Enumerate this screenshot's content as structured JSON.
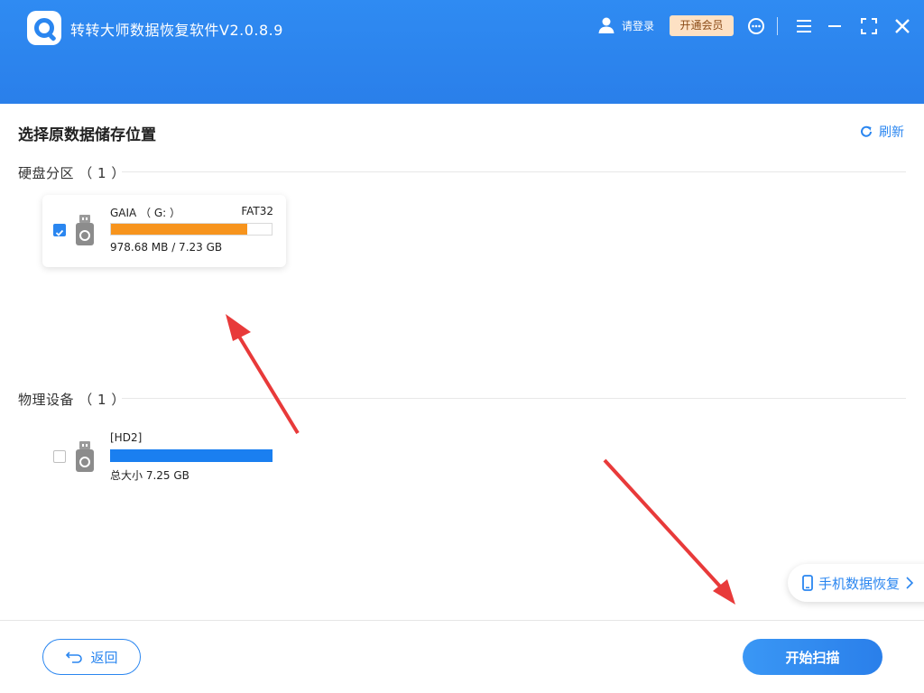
{
  "header": {
    "app_title": "转转大师数据恢复软件V2.0.8.9",
    "login_label": "请登录",
    "vip_label": "开通会员",
    "icons": [
      "logo-icon",
      "user-icon",
      "customer-service-icon",
      "menu-icon",
      "minimize-icon",
      "maximize-icon",
      "close-icon"
    ]
  },
  "main": {
    "page_title": "选择原数据储存位置",
    "refresh_label": "刷新",
    "partitions": {
      "title": "硬盘分区 （ 1 ）",
      "items": [
        {
          "name": "GAIA （ G: ）",
          "fs": "FAT32",
          "size": "978.68 MB / 7.23 GB",
          "usage": 0.85,
          "checked": true,
          "bar_color": "#f7941d"
        }
      ]
    },
    "physical": {
      "title": "物理设备 （ 1 ）",
      "items": [
        {
          "name": "[HD2]",
          "size": "总大小 7.25 GB",
          "usage": 1.0,
          "checked": false,
          "bar_color": "#1a7ff0"
        }
      ]
    },
    "phone_recovery_label": "手机数据恢复"
  },
  "footer": {
    "back_label": "返回",
    "scan_label": "开始扫描"
  },
  "colors": {
    "accent": "#2a86f0",
    "annotation_arrow": "#e83a3a"
  }
}
